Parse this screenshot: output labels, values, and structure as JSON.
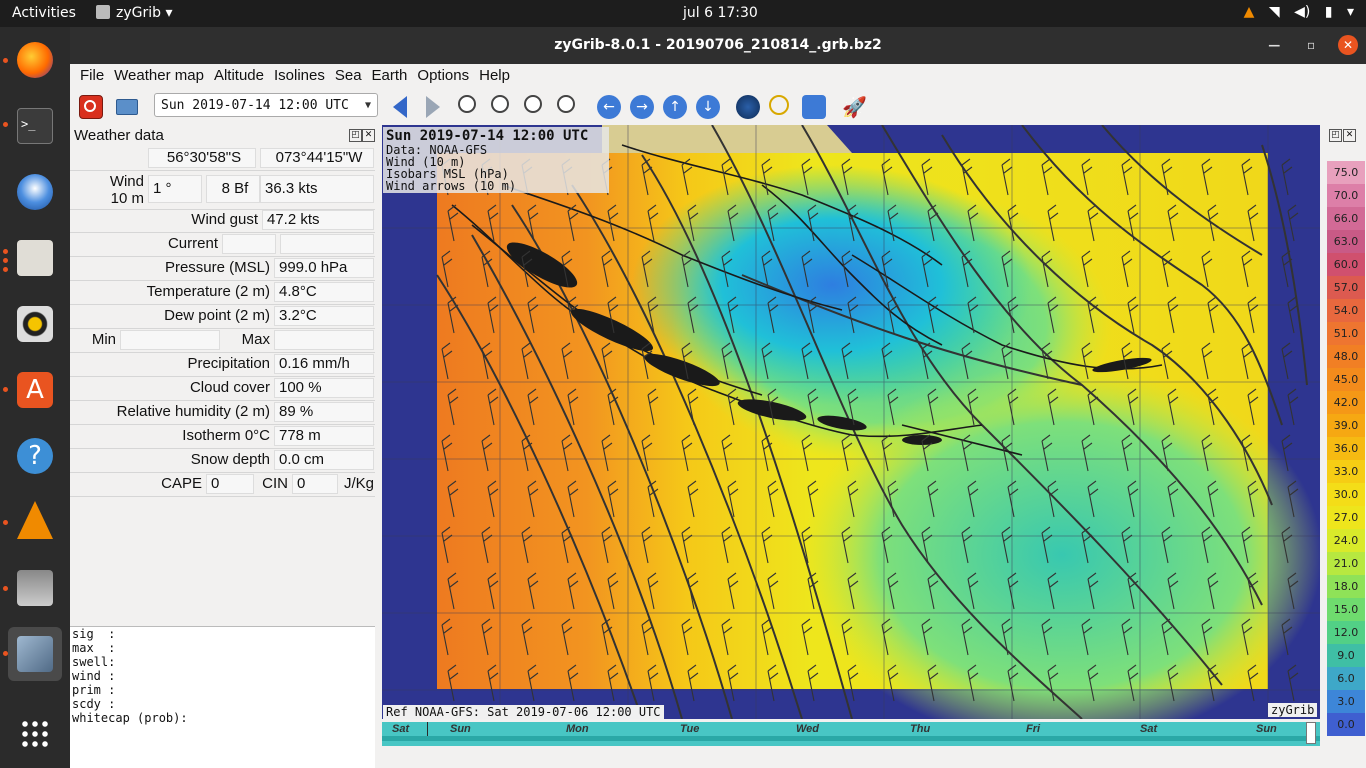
{
  "topbar": {
    "activities": "Activities",
    "app_name": "zyGrib",
    "clock": "jul 6  17:30"
  },
  "window": {
    "title": "zyGrib-8.0.1 - 20190706_210814_.grb.bz2"
  },
  "menu": [
    "File",
    "Weather map",
    "Altitude",
    "Isolines",
    "Sea",
    "Earth",
    "Options",
    "Help"
  ],
  "toolbar": {
    "date_selected": "Sun 2019-07-14 12:00 UTC"
  },
  "panel": {
    "title": "Weather data",
    "lat": "56°30'58\"S",
    "lon": "073°44'15\"W",
    "wind_label_1": "Wind",
    "wind_label_2": "10 m",
    "wind_dir": "1 °",
    "wind_bf": "8 Bf",
    "wind_speed": "36.3  kts",
    "gust_label": "Wind gust",
    "gust_value": "47.2  kts",
    "current_label": "Current",
    "pressure_label": "Pressure (MSL)",
    "pressure_value": "999.0 hPa",
    "temp_label": "Temperature (2 m)",
    "temp_value": "4.8°C",
    "dew_label": "Dew point (2 m)",
    "dew_value": "3.2°C",
    "min_label": "Min",
    "max_label": "Max",
    "precip_label": "Precipitation",
    "precip_value": "0.16 mm/h",
    "cloud_label": "Cloud cover",
    "cloud_value": "100 %",
    "rh_label": "Relative humidity (2 m)",
    "rh_value": "89 %",
    "iso_label": "Isotherm 0°C",
    "iso_value": "778 m",
    "snow_label": "Snow depth",
    "snow_value": "0.0 cm",
    "cape_label": "CAPE",
    "cape_value": "0",
    "cin_label": "CIN",
    "cin_value": "0",
    "cape_unit": "J/Kg"
  },
  "wave_text": "sig  :\nmax  :\nswell:\nwind :\nprim :\nscdy :\nwhitecap (prob):",
  "map": {
    "date": "Sun 2019-07-14 12:00 UTC",
    "data": "Data: NOAA-GFS",
    "l1": "Wind (10 m)",
    "l2": "Isobars MSL (hPa)",
    "l3": "Wind arrows (10 m)",
    "ref": "Ref NOAA-GFS: Sat 2019-07-06 12:00 UTC",
    "brand": "zyGrib"
  },
  "timeline_days": [
    "Sat",
    "Sun",
    "Mon",
    "Tue",
    "Wed",
    "Thu",
    "Fri",
    "Sat",
    "Sun"
  ],
  "legend": {
    "values": [
      "75.0",
      "70.0",
      "66.0",
      "63.0",
      "60.0",
      "57.0",
      "54.0",
      "51.0",
      "48.0",
      "45.0",
      "42.0",
      "39.0",
      "36.0",
      "33.0",
      "30.0",
      "27.0",
      "24.0",
      "21.0",
      "18.0",
      "15.0",
      "12.0",
      "9.0",
      "6.0",
      "3.0",
      "0.0"
    ],
    "colors": [
      "#e8a0bd",
      "#dd7fa8",
      "#d26a96",
      "#c95a86",
      "#d0506e",
      "#dc5a50",
      "#e8683e",
      "#ee7530",
      "#f17f24",
      "#f38b1c",
      "#f59816",
      "#f6a812",
      "#f6ba12",
      "#f6cd14",
      "#f4dd18",
      "#eee51c",
      "#d9ea2a",
      "#b7e840",
      "#8fe258",
      "#6fdb6e",
      "#52d086",
      "#3fbfa5",
      "#3ea8c8",
      "#3d86d8",
      "#3f5fd0"
    ]
  }
}
